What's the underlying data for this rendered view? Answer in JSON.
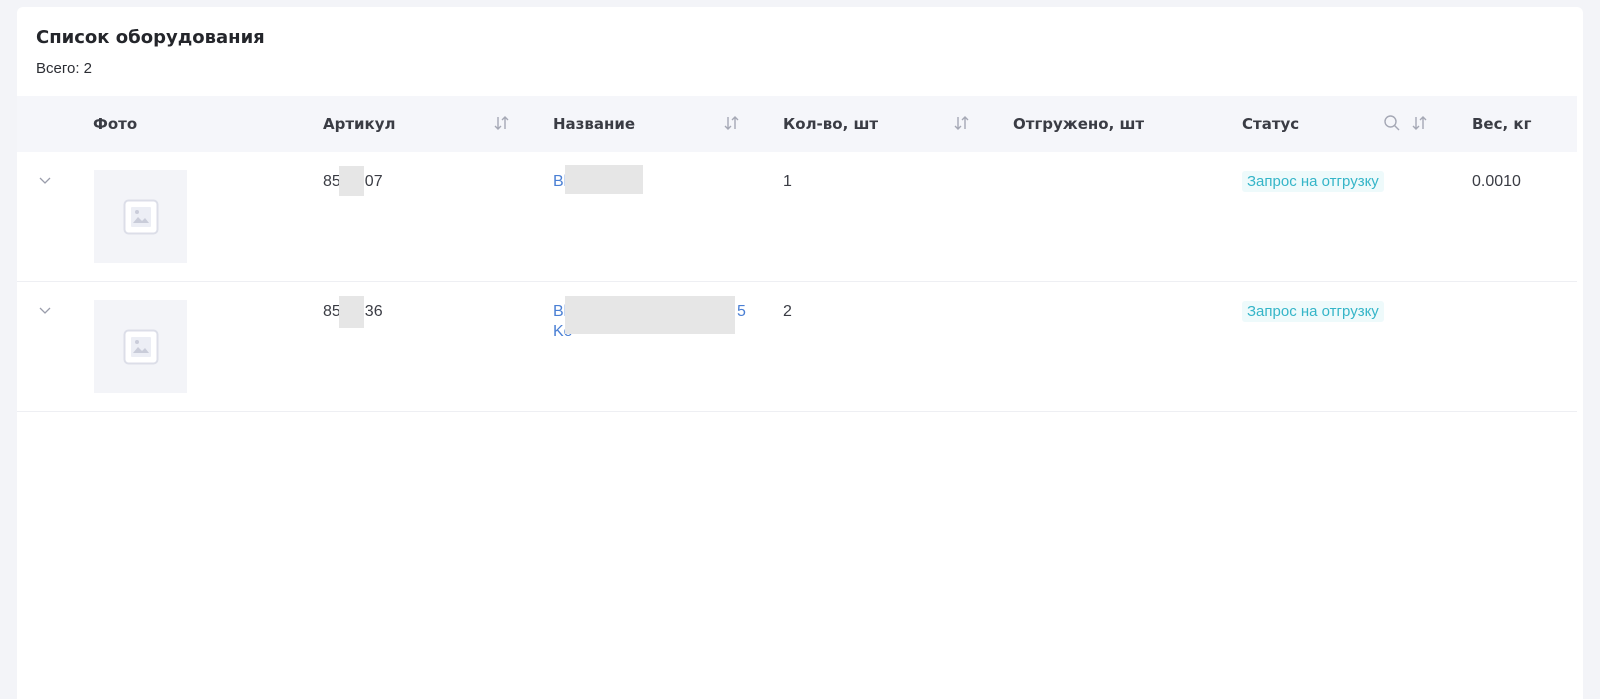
{
  "page": {
    "title": "Список оборудования",
    "total": "Всего: 2"
  },
  "columns": {
    "photo": "Фото",
    "article": "Артикул",
    "name": "Название",
    "qty": "Кол-во, шт",
    "shipped": "Отгружено, шт",
    "status": "Статус",
    "weight": "Вес, кг"
  },
  "rows": [
    {
      "article_start": "85",
      "article_end": "07",
      "name_line1_start": "Bl",
      "name_line1_end": "",
      "name_line2": "",
      "qty": "1",
      "shipped": "",
      "status": "Запрос на отгрузку",
      "weight": "0.0010"
    },
    {
      "article_start": "85",
      "article_end": "36",
      "name_line1_start": "Bl",
      "name_line1_end": "5",
      "name_line2": "Ko",
      "qty": "2",
      "shipped": "",
      "status": "Запрос на отгрузку",
      "weight": ""
    }
  ],
  "colors": {
    "link": "#4a7fd4",
    "status_text": "#35b5c8",
    "status_bg": "#eefafb",
    "header_bg": "#f5f6fa"
  },
  "icons": {
    "sort": "sort-arrows-icon",
    "search": "search-icon",
    "expand": "chevron-down-icon",
    "placeholder": "image-placeholder-icon"
  }
}
